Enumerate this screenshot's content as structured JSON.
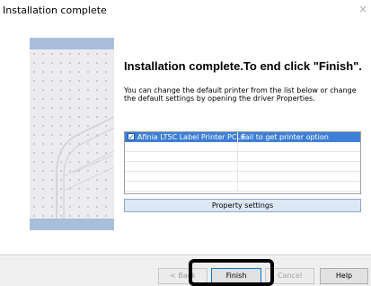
{
  "window": {
    "title": "Installation complete",
    "close_glyph": "×"
  },
  "heading": "Installation complete.To end click \"Finish\".",
  "description": "You can change the default printer from the list below or change the default settings by opening the driver Properties.",
  "printer_list": {
    "rows": [
      {
        "checked": true,
        "printer": "Afinia LT5C Label Printer PCL6",
        "status": "Fail to get printer option",
        "selected": true
      }
    ],
    "empty_rows": 5
  },
  "property_button": "Property settings",
  "buttons": {
    "back": "< Back",
    "finish": "Finish",
    "cancel": "Cancel",
    "help": "Help"
  },
  "colors": {
    "selection": "#3e7fd6",
    "side_stripe": "#a8bedb",
    "highlight_box": "#000000"
  },
  "icons": {
    "side_image": "printer-illustration",
    "close": "close-icon",
    "check": "checkbox-checked-icon"
  }
}
